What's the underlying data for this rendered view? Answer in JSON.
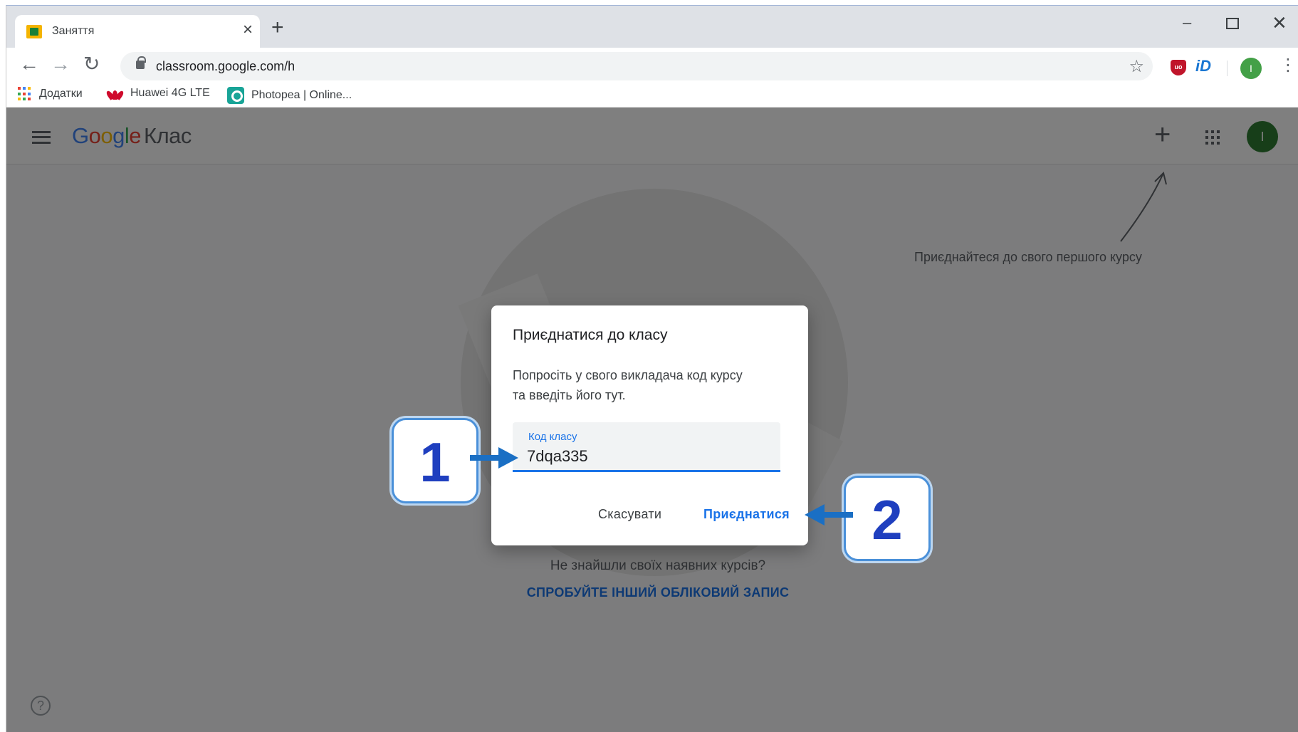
{
  "browser": {
    "tab_title": "Заняття",
    "tab_close": "×",
    "new_tab": "+",
    "url": "classroom.google.com/h",
    "window_controls": {
      "minimize": "–",
      "close": "✕"
    },
    "profile_initial": "I",
    "extensions": {
      "ublock_label": "uo",
      "idm_label": "iD"
    },
    "bookmarks": [
      {
        "label": "Додатки",
        "icon": "apps-grid-icon"
      },
      {
        "label": "Huawei 4G LTE",
        "icon": "huawei-icon"
      },
      {
        "label": "Photopea | Online...",
        "icon": "photopea-icon"
      }
    ]
  },
  "header": {
    "logo_letters": [
      "G",
      "o",
      "o",
      "g",
      "l",
      "e"
    ],
    "logo_product": "Клас",
    "add_button": "+",
    "avatar_initial": "I"
  },
  "page": {
    "first_course_hint": "Приєднайтеся до свого першого курсу",
    "no_courses_text": "Не знайшли своїх наявних курсів?",
    "switch_account_link": "СПРОБУЙТЕ ІНШИЙ ОБЛІКОВИЙ ЗАПИС",
    "help_icon": "?"
  },
  "dialog": {
    "title": "Приєднатися до класу",
    "description": "Попросіть у свого викладача код курсу та введіть його тут.",
    "code_label": "Код класу",
    "code_value": "7dqa335",
    "cancel_label": "Скасувати",
    "join_label": "Приєднатися"
  },
  "callouts": {
    "first": "1",
    "second": "2"
  },
  "colors": {
    "accent": "#1a73e8",
    "callout_number": "#1f3fbf",
    "avatar": "#2e7d32"
  }
}
